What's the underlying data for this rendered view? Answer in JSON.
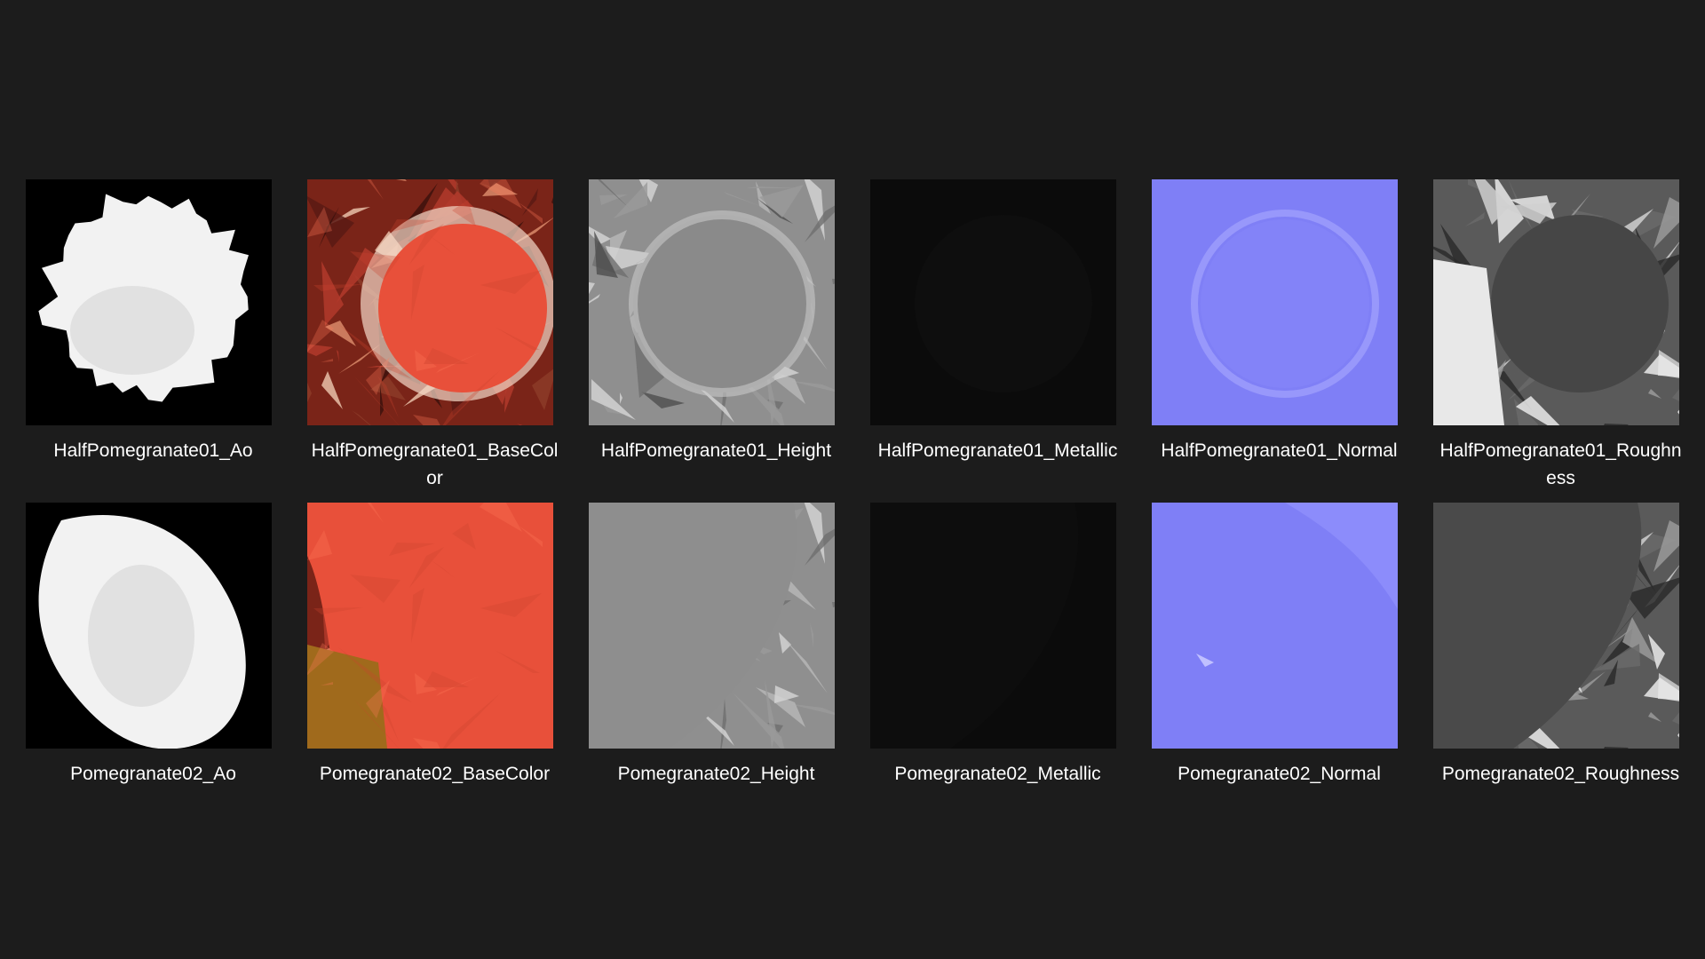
{
  "files": [
    {
      "name": "HalfPomegranate01_Ao",
      "label_lines": [
        "HalfPomegranate01_Ao"
      ],
      "map": "ao",
      "variant": "half",
      "thumb_icon": "ao-map-thumbnail-icon"
    },
    {
      "name": "HalfPomegranate01_BaseColor",
      "label_lines": [
        "HalfPomegranate01_BaseCol",
        "or"
      ],
      "map": "basecolor",
      "variant": "half",
      "thumb_icon": "basecolor-map-thumbnail-icon"
    },
    {
      "name": "HalfPomegranate01_Height",
      "label_lines": [
        "HalfPomegranate01_Height"
      ],
      "map": "height",
      "variant": "half",
      "thumb_icon": "height-map-thumbnail-icon"
    },
    {
      "name": "HalfPomegranate01_Metallic",
      "label_lines": [
        "HalfPomegranate01_Metallic"
      ],
      "map": "metallic",
      "variant": "half",
      "thumb_icon": "metallic-map-thumbnail-icon"
    },
    {
      "name": "HalfPomegranate01_Normal",
      "label_lines": [
        "HalfPomegranate01_Normal"
      ],
      "map": "normal",
      "variant": "half",
      "thumb_icon": "normal-map-thumbnail-icon"
    },
    {
      "name": "HalfPomegranate01_Roughness",
      "label_lines": [
        "HalfPomegranate01_Roughn",
        "ess"
      ],
      "map": "roughness",
      "variant": "half",
      "thumb_icon": "roughness-map-thumbnail-icon"
    },
    {
      "name": "Pomegranate02_Ao",
      "label_lines": [
        "Pomegranate02_Ao"
      ],
      "map": "ao",
      "variant": "whole",
      "thumb_icon": "ao-map-thumbnail-icon"
    },
    {
      "name": "Pomegranate02_BaseColor",
      "label_lines": [
        "Pomegranate02_BaseColor"
      ],
      "map": "basecolor",
      "variant": "whole",
      "thumb_icon": "basecolor-map-thumbnail-icon"
    },
    {
      "name": "Pomegranate02_Height",
      "label_lines": [
        "Pomegranate02_Height"
      ],
      "map": "height",
      "variant": "whole",
      "thumb_icon": "height-map-thumbnail-icon"
    },
    {
      "name": "Pomegranate02_Metallic",
      "label_lines": [
        "Pomegranate02_Metallic"
      ],
      "map": "metallic",
      "variant": "whole",
      "thumb_icon": "metallic-map-thumbnail-icon"
    },
    {
      "name": "Pomegranate02_Normal",
      "label_lines": [
        "Pomegranate02_Normal"
      ],
      "map": "normal",
      "variant": "whole",
      "thumb_icon": "normal-map-thumbnail-icon"
    },
    {
      "name": "Pomegranate02_Roughness",
      "label_lines": [
        "Pomegranate02_Roughness"
      ],
      "map": "roughness",
      "variant": "whole",
      "thumb_icon": "roughness-map-thumbnail-icon"
    }
  ],
  "colors": {
    "background": "#1c1c1c",
    "label_text": "#ffffff",
    "ao_bg": "#000000",
    "ao_fg": "#f2f2f2",
    "basecolor_bg": "#7a2418",
    "basecolor_fruit": "#e8503a",
    "height_bg": "#8f8f8f",
    "metallic_bg": "#0b0b0b",
    "normal_bg": "#7f7ff6",
    "roughness_bg": "#5a5a5a"
  }
}
